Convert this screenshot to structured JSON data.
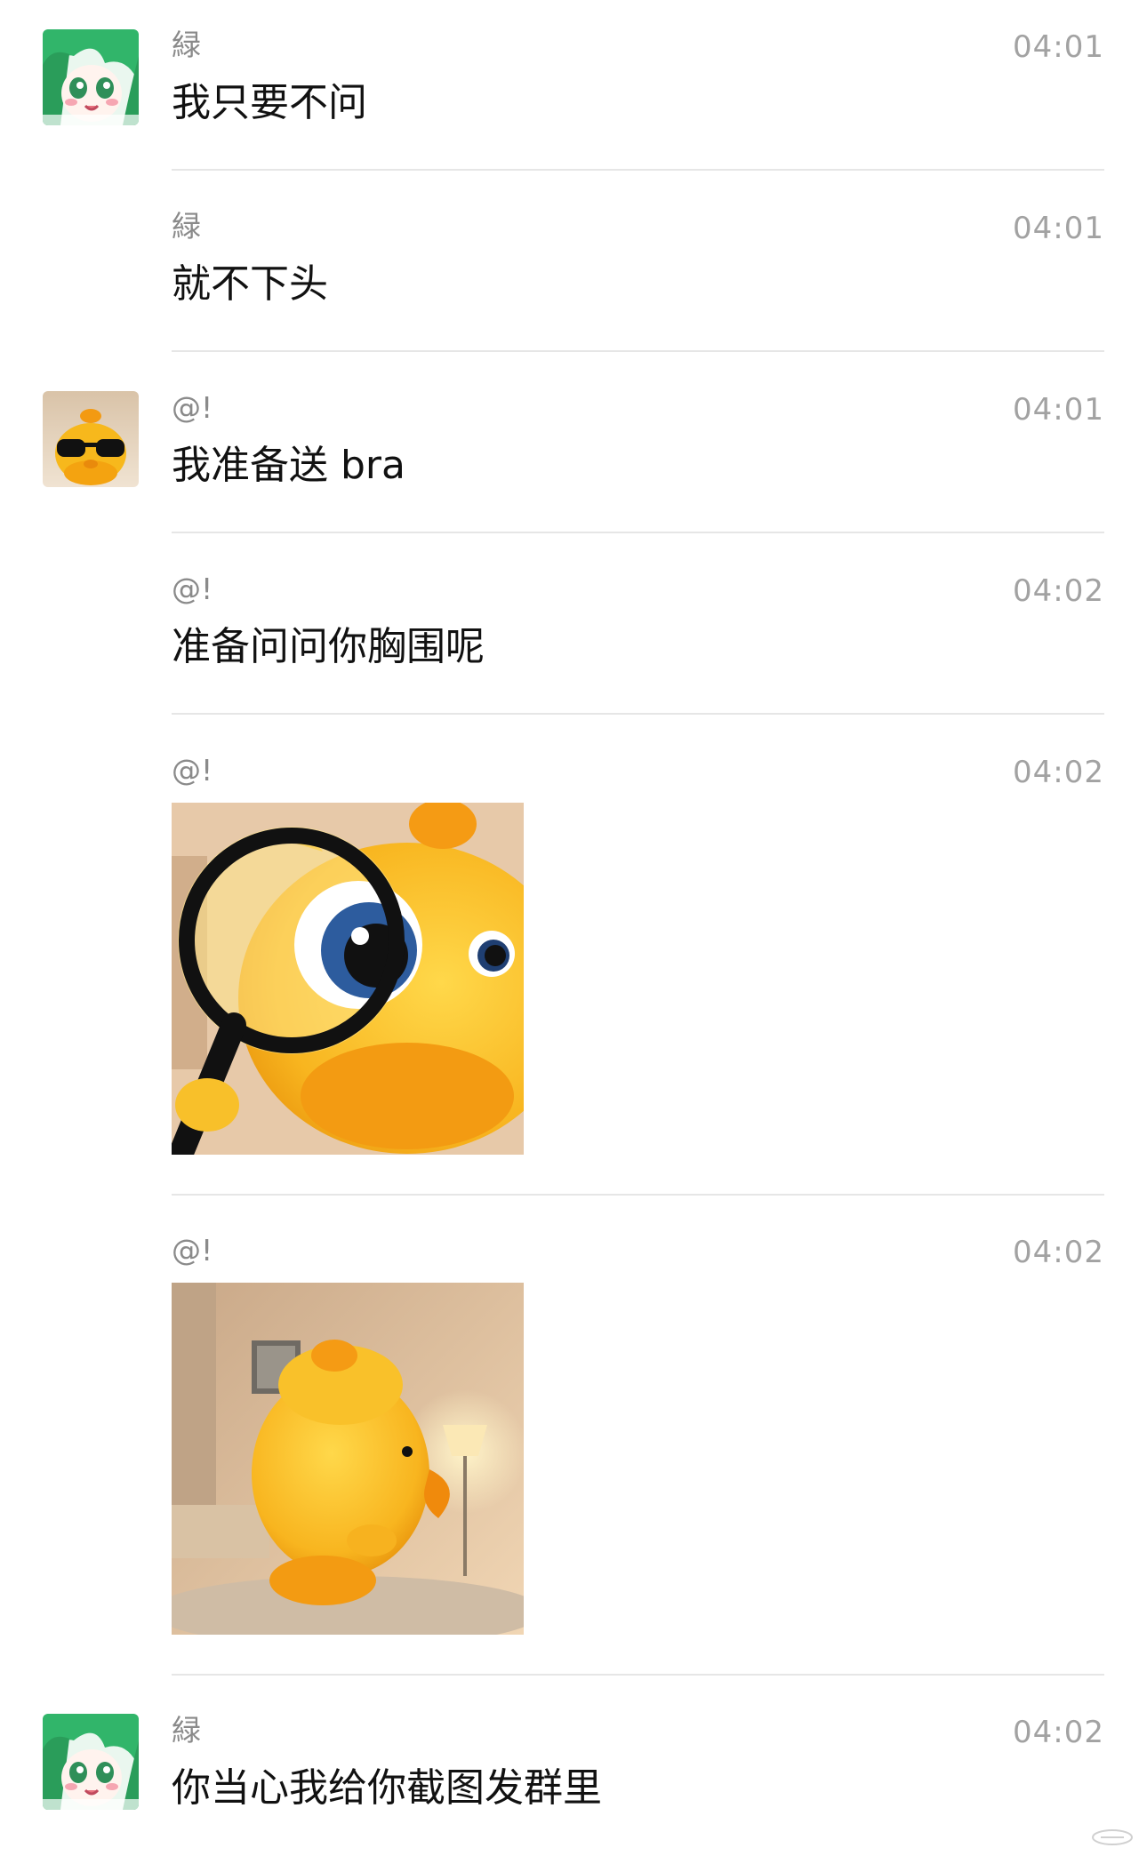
{
  "messages": [
    {
      "sender": "緑",
      "time": "04:01",
      "text": "我只要不问"
    },
    {
      "sender": "緑",
      "time": "04:01",
      "text": "就不下头"
    },
    {
      "sender": "@!",
      "time": "04:01",
      "text": "我准备送 bra"
    },
    {
      "sender": "@!",
      "time": "04:02",
      "text": "准备问问你胸围呢"
    },
    {
      "sender": "@!",
      "time": "04:02",
      "sticker": "yellow-duck-magnifying-glass"
    },
    {
      "sender": "@!",
      "time": "04:02",
      "sticker": "yellow-duck-looking-away"
    },
    {
      "sender": "緑",
      "time": "04:02",
      "text": "你当心我给你截图发群里"
    }
  ],
  "avatars": {
    "green": "green-hair-anime-avatar",
    "duck": "duck-sunglasses-avatar"
  },
  "colors": {
    "background": "#ffffff",
    "text": "#111111",
    "meta": "#8a8a8a",
    "divider": "#e6e6e6",
    "duck": "#f7b81c"
  }
}
